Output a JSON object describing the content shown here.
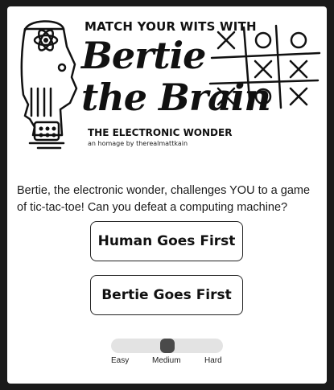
{
  "header": {
    "tagline": "MATCH YOUR WITS WITH",
    "title_line1": "Bertie",
    "title_line2": "the Brain",
    "subtitle": "THE ELECTRONIC WONDER",
    "credit": "an homage by therealmattkain"
  },
  "intro": "Bertie, the electronic wonder, challenges YOU to a game of tic-tac-toe! Can you defeat a computing machine?",
  "buttons": {
    "human_first": "Human Goes First",
    "bertie_first": "Bertie Goes First"
  },
  "difficulty": {
    "options": [
      "Easy",
      "Medium",
      "Hard"
    ],
    "selected": "Medium",
    "selected_index": 1
  },
  "decor_board": [
    "X",
    "O",
    "O",
    "",
    "X",
    "X",
    "X",
    "O",
    "X"
  ],
  "colors": {
    "background": "#1a1a1a",
    "panel": "#ffffff",
    "ink": "#111111",
    "track": "#e3e3e3",
    "thumb": "#4a4a4a"
  }
}
